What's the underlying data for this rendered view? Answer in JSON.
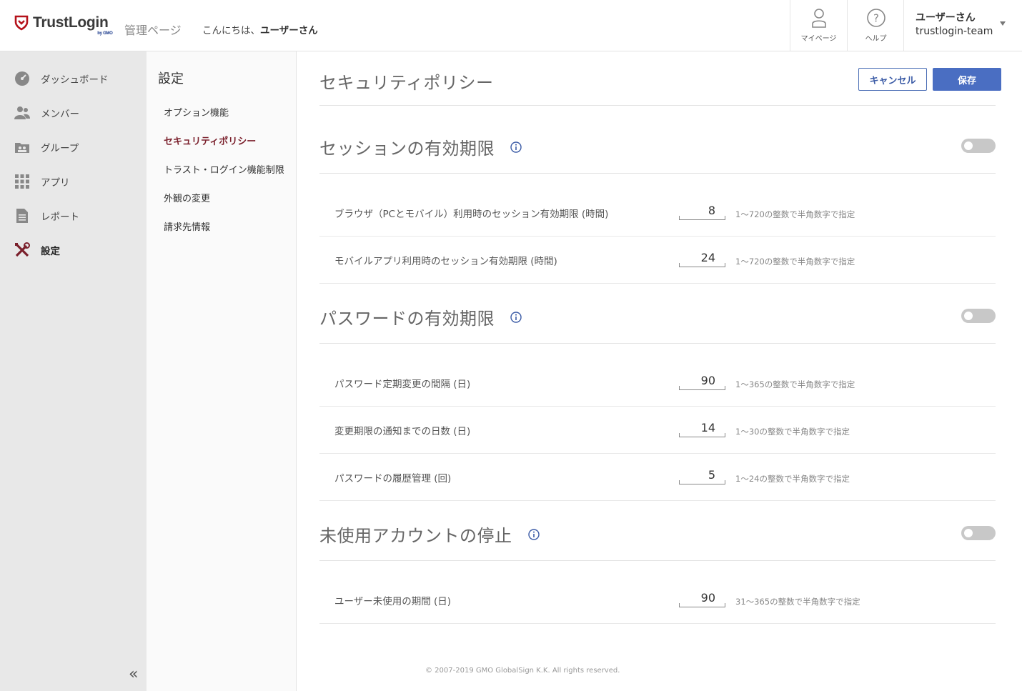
{
  "header": {
    "brand": "TrustLogin",
    "brand_sub": "by GMO",
    "admin_label": "管理ページ",
    "greeting_prefix": "こんにちは、",
    "greeting_user": "ユーザーさん",
    "mypage_label": "マイページ",
    "help_label": "ヘルプ",
    "user_name": "ユーザーさん",
    "user_team": "trustlogin-team"
  },
  "sidebar": {
    "items": [
      {
        "label": "ダッシュボード",
        "icon": "dashboard-icon"
      },
      {
        "label": "メンバー",
        "icon": "members-icon"
      },
      {
        "label": "グループ",
        "icon": "group-icon"
      },
      {
        "label": "アプリ",
        "icon": "apps-icon"
      },
      {
        "label": "レポート",
        "icon": "report-icon"
      },
      {
        "label": "設定",
        "icon": "settings-icon",
        "active": true
      }
    ],
    "collapse": "«"
  },
  "subnav": {
    "title": "設定",
    "items": [
      {
        "label": "オプション機能"
      },
      {
        "label": "セキュリティポリシー",
        "active": true
      },
      {
        "label": "トラスト・ログイン機能制限"
      },
      {
        "label": "外観の変更"
      },
      {
        "label": "請求先情報"
      }
    ]
  },
  "main": {
    "title": "セキュリティポリシー",
    "cancel_label": "キャンセル",
    "save_label": "保存",
    "sections": [
      {
        "title": "セッションの有効期限",
        "enabled": false,
        "rows": [
          {
            "label": "ブラウザ（PCとモバイル）利用時のセッション有効期限 (時間)",
            "value": "8",
            "hint": "1〜720の整数で半角数字で指定"
          },
          {
            "label": "モバイルアプリ利用時のセッション有効期限 (時間)",
            "value": "24",
            "hint": "1〜720の整数で半角数字で指定"
          }
        ]
      },
      {
        "title": "パスワードの有効期限",
        "enabled": false,
        "rows": [
          {
            "label": "パスワード定期変更の間隔 (日)",
            "value": "90",
            "hint": "1〜365の整数で半角数字で指定"
          },
          {
            "label": "変更期限の通知までの日数 (日)",
            "value": "14",
            "hint": "1〜30の整数で半角数字で指定"
          },
          {
            "label": "パスワードの履歴管理 (回)",
            "value": "5",
            "hint": "1〜24の整数で半角数字で指定"
          }
        ]
      },
      {
        "title": "未使用アカウントの停止",
        "enabled": false,
        "rows": [
          {
            "label": "ユーザー未使用の期間 (日)",
            "value": "90",
            "hint": "31〜365の整数で半角数字で指定"
          }
        ]
      }
    ]
  },
  "footer": {
    "copyright": "© 2007-2019 GMO GlobalSign K.K. All rights reserved."
  },
  "colors": {
    "accent": "#4a6ec2",
    "active_subnav": "#7a1f2b",
    "brand_red": "#b5121b"
  }
}
